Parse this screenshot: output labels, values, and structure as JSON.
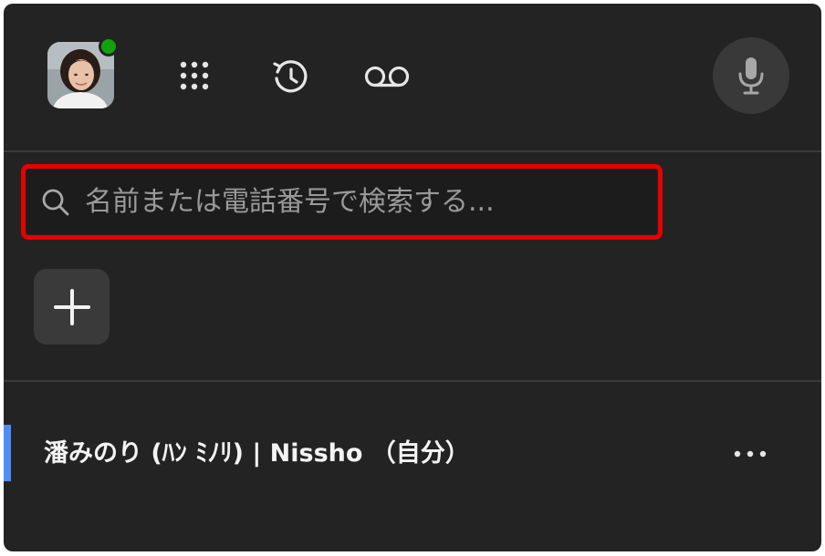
{
  "header": {
    "avatar_icon": "user-avatar-photo",
    "presence_status": "online",
    "presence_color": "#13a10e",
    "dialpad_icon": "dialpad-icon",
    "history_icon": "call-history-icon",
    "voicemail_icon": "voicemail-icon",
    "mic_icon": "microphone-icon"
  },
  "search": {
    "placeholder": "名前または電話番号で検索する...",
    "value": "",
    "highlight_color": "#e60000"
  },
  "actions": {
    "add_icon": "plus-icon"
  },
  "contacts": [
    {
      "name": "潘みのり (ﾊﾝ ﾐﾉﾘ) | Nissho （自分）",
      "accent_color": "#4f8ef7",
      "more_icon": "more-horizontal-icon"
    }
  ]
}
